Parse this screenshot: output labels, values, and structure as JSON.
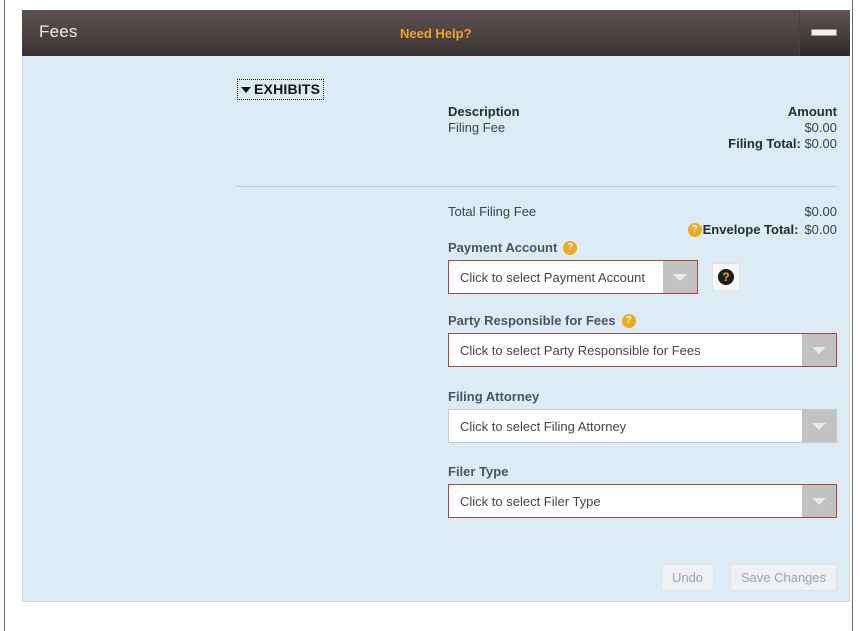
{
  "titlebar": {
    "title": "Fees",
    "help_link": "Need Help?",
    "minimize_icon": "minimize-icon"
  },
  "exhibits": {
    "label": "EXHIBITS",
    "caret_icon": "caret-down-icon"
  },
  "fee_table": {
    "col_description": "Description",
    "col_amount": "Amount",
    "rows": [
      {
        "description": "Filing Fee",
        "amount": "$0.00"
      }
    ],
    "filing_total_label": "Filing Total:",
    "filing_total_amount": "$0.00"
  },
  "totals": {
    "total_filing_fee_label": "Total Filing Fee",
    "total_filing_fee_amount": "$0.00",
    "envelope_total_label": "Envelope Total:",
    "envelope_total_amount": "$0.00",
    "envelope_help_icon": "help-icon",
    "help_glyph": "?"
  },
  "fields": {
    "payment_account": {
      "label": "Payment Account",
      "value": "Click to select Payment Account",
      "help_icon": "help-icon",
      "has_help": true,
      "invalid": true,
      "side_help_button": "help-button"
    },
    "party_responsible": {
      "label": "Party Responsible for Fees",
      "value": "Click to select Party Responsible for Fees",
      "help_icon": "help-icon",
      "has_help": true,
      "invalid": true
    },
    "filing_attorney": {
      "label": "Filing Attorney",
      "value": "Click to select Filing Attorney",
      "has_help": false,
      "invalid": false
    },
    "filer_type": {
      "label": "Filer Type",
      "value": "Click to select Filer Type",
      "has_help": false,
      "invalid": true
    },
    "dropdown_arrow_icon": "chevron-down-icon",
    "help_glyph": "?"
  },
  "footer": {
    "undo_label": "Undo",
    "save_label": "Save Changes"
  },
  "colors": {
    "panel_background": "#dcebf4",
    "titlebar": "#4e4644",
    "accent_orange": "#f0a42a",
    "error_border": "#a94442",
    "text": "#3d434a"
  }
}
